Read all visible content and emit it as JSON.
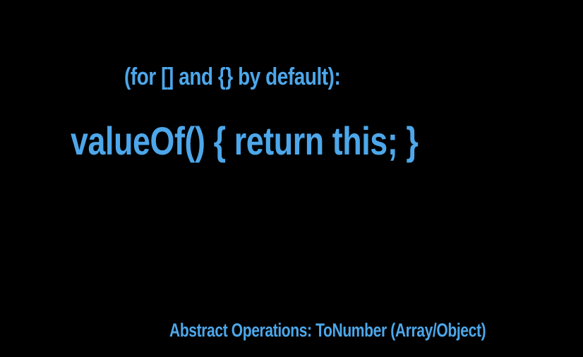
{
  "slide": {
    "subtitle": "(for [] and {} by default):",
    "code": "valueOf() { return this; }",
    "footer": "Abstract Operations: ToNumber (Array/Object)"
  },
  "colors": {
    "background": "#000000",
    "text": "#4da7ea"
  }
}
